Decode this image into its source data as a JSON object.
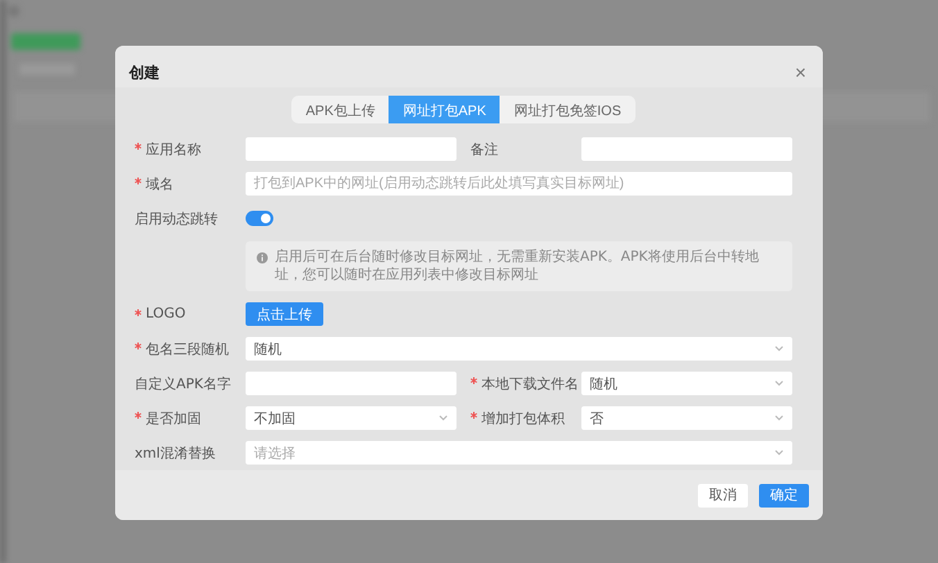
{
  "dialog": {
    "title": "创建",
    "close": "×"
  },
  "tabs": [
    {
      "label": "APK包上传",
      "selected": false
    },
    {
      "label": "网址打包APK",
      "selected": true
    },
    {
      "label": "网址打包免签IOS",
      "selected": false
    }
  ],
  "rows": [
    {
      "fields": [
        {
          "kind": "input",
          "label": "应用名称",
          "required": true
        },
        {
          "kind": "input",
          "label": "备注",
          "required": false
        }
      ]
    },
    {
      "fields": [
        {
          "kind": "input",
          "label": "域名",
          "required": true,
          "placeholder": "打包到APK中的网址(启用动态跳转后此处填写真实目标网址)"
        }
      ]
    },
    {
      "fields": [
        {
          "kind": "switch",
          "label": "启用动态跳转",
          "required": false,
          "on": true
        }
      ]
    },
    {
      "fields": [
        {
          "kind": "info",
          "text": "启用后可在后台随时修改目标网址，无需重新安装APK。APK将使用后台中转地址，您可以随时在应用列表中修改目标网址"
        }
      ]
    },
    {
      "fields": [
        {
          "kind": "upload",
          "label": "LOGO",
          "required": true,
          "button": "点击上传"
        }
      ]
    },
    {
      "fields": [
        {
          "kind": "select",
          "label": "包名三段随机",
          "required": true,
          "value": "随机"
        }
      ]
    },
    {
      "fields": [
        {
          "kind": "input",
          "label": "自定义APK名字",
          "required": false
        },
        {
          "kind": "select",
          "label": "本地下载文件名",
          "required": true,
          "value": "随机"
        }
      ]
    },
    {
      "fields": [
        {
          "kind": "select",
          "label": "是否加固",
          "required": true,
          "value": "不加固"
        },
        {
          "kind": "select",
          "label": "增加打包体积",
          "required": true,
          "value": "否"
        }
      ]
    },
    {
      "fields": [
        {
          "kind": "select",
          "label": "xml混淆替换",
          "required": false,
          "placeholder": "请选择"
        }
      ]
    }
  ],
  "footer": {
    "buttons": [
      {
        "label": "取消",
        "primary": false
      },
      {
        "label": "确定",
        "primary": true
      }
    ]
  }
}
